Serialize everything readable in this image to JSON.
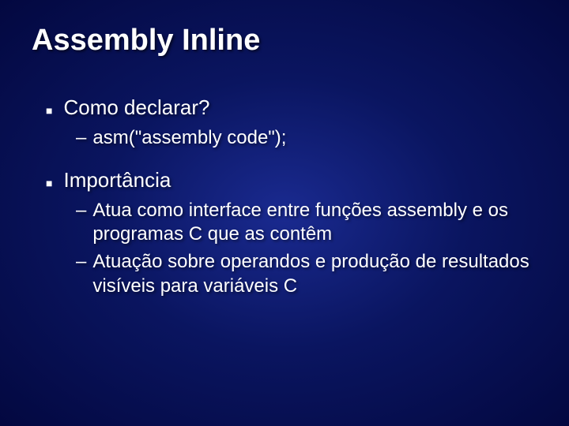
{
  "title": "Assembly Inline",
  "bullets": [
    {
      "text": "Como declarar?",
      "subs": [
        "asm(\"assembly code\");"
      ]
    },
    {
      "text": "Importância",
      "subs": [
        "Atua como interface entre funções assembly e os programas C que as contêm",
        "Atuação sobre operandos e produção de resultados visíveis para variáveis C"
      ]
    }
  ]
}
